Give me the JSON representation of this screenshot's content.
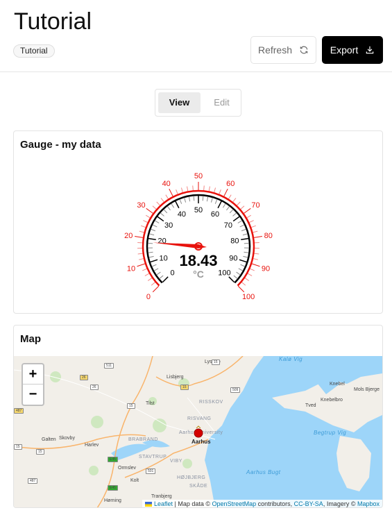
{
  "header": {
    "title": "Tutorial",
    "badge": "Tutorial",
    "refresh_label": "Refresh",
    "export_label": "Export"
  },
  "mode_toggle": {
    "options": [
      "View",
      "Edit"
    ],
    "selected": "View"
  },
  "gauge_card": {
    "title": "Gauge - my data",
    "gauge": {
      "value": "18.43",
      "unit": "°C",
      "min": 0,
      "max": 100,
      "major_step": 10,
      "outer_ticks": [
        "0",
        "10",
        "20",
        "30",
        "40",
        "50",
        "60",
        "70",
        "80",
        "90",
        "100"
      ],
      "inner_ticks": [
        "0",
        "10",
        "20",
        "30",
        "40",
        "50",
        "60",
        "70",
        "80",
        "90",
        "100"
      ],
      "outer_color": "#e8120c",
      "inner_color": "#000000",
      "needle_color": "#e8120c"
    }
  },
  "map_card": {
    "title": "Map",
    "zoom_in": "+",
    "zoom_out": "−",
    "labels": [
      "Lystrup",
      "Lisbjerg",
      "Tilst",
      "RISSKOV",
      "RISVANG",
      "Aarhus University",
      "Aarhus",
      "BRABRAND",
      "Galten",
      "Skovby",
      "Harlev",
      "STAVTRUP",
      "VIBY",
      "Ormslev",
      "HØJBJERG",
      "SKÅDE",
      "Kolt",
      "Tranbjerg",
      "Hørning",
      "Kalø Vig",
      "Begtrup Vig",
      "Aarhus Bugt",
      "Knebel",
      "Knebelbro",
      "Tved",
      "Mols Bjerge"
    ],
    "road_shields": [
      "511",
      "26",
      "26",
      "15",
      "15",
      "15",
      "509",
      "487",
      "15",
      "15",
      "E45",
      "501",
      "487",
      "E45"
    ],
    "attribution": {
      "leaflet": "Leaflet",
      "sep1": " | Map data © ",
      "osm": "OpenStreetMap",
      "sep2": " contributors, ",
      "license": "CC-BY-SA",
      "sep3": ", Imagery © ",
      "mapbox": "Mapbox"
    },
    "colors": {
      "land": "#f2efe9",
      "water": "#9dd5f9",
      "park": "#cfe8c0",
      "road": "#f9b46b",
      "marker": "#d40000"
    }
  }
}
